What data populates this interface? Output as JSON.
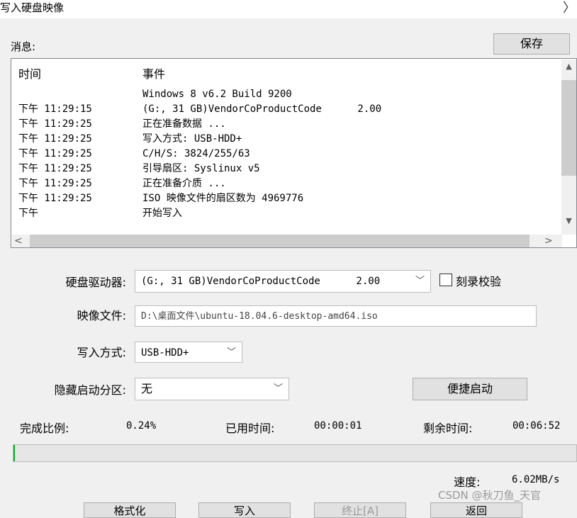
{
  "window": {
    "title": "写入硬盘映像",
    "close_glyph": "〉"
  },
  "messages": {
    "label": "消息:",
    "save_label": "保存",
    "columns": {
      "time": "时间",
      "event": "事件"
    },
    "rows": [
      {
        "time": "",
        "event": "Windows 8 v6.2 Build 9200"
      },
      {
        "time": "下午 11:29:15",
        "event": "(G:, 31 GB)VendorCoProductCode      2.00"
      },
      {
        "time": "下午 11:29:25",
        "event": "正在准备数据 ..."
      },
      {
        "time": "下午 11:29:25",
        "event": "写入方式: USB-HDD+"
      },
      {
        "time": "下午 11:29:25",
        "event": "C/H/S: 3824/255/63"
      },
      {
        "time": "下午 11:29:25",
        "event": "引导扇区: Syslinux v5"
      },
      {
        "time": "下午 11:29:25",
        "event": "正在准备介质 ..."
      },
      {
        "time": "下午 11:29:25",
        "event": "ISO 映像文件的扇区数为 4969776"
      },
      {
        "time": "下午",
        "event": "开始写入"
      }
    ]
  },
  "form": {
    "drive": {
      "label": "硬盘驱动器:",
      "value": "(G:, 31 GB)VendorCoProductCode      2.00"
    },
    "verify": {
      "label": "刻录校验",
      "checked": false
    },
    "image": {
      "label": "映像文件:",
      "value": "D:\\桌面文件\\ubuntu-18.04.6-desktop-amd64.iso"
    },
    "mode": {
      "label": "写入方式:",
      "value": "USB-HDD+"
    },
    "hidden": {
      "label": "隐藏启动分区:",
      "value": "无"
    },
    "boot_button": "便捷启动"
  },
  "progress": {
    "ratio_label": "完成比例:",
    "ratio_value": "0.24%",
    "percent": 0.24,
    "elapsed_label": "已用时间:",
    "elapsed_value": "00:00:01",
    "remaining_label": "剩余时间:",
    "remaining_value": "00:06:52",
    "speed_label": "速度:",
    "speed_value": "6.02MB/s"
  },
  "buttons": [
    "格式化",
    "写入",
    "终止[A]",
    "返回"
  ],
  "watermark": "CSDN @秋刀鱼_天官",
  "colors": {
    "progress_fill": "#06b025",
    "background": "#f0f0f0"
  }
}
